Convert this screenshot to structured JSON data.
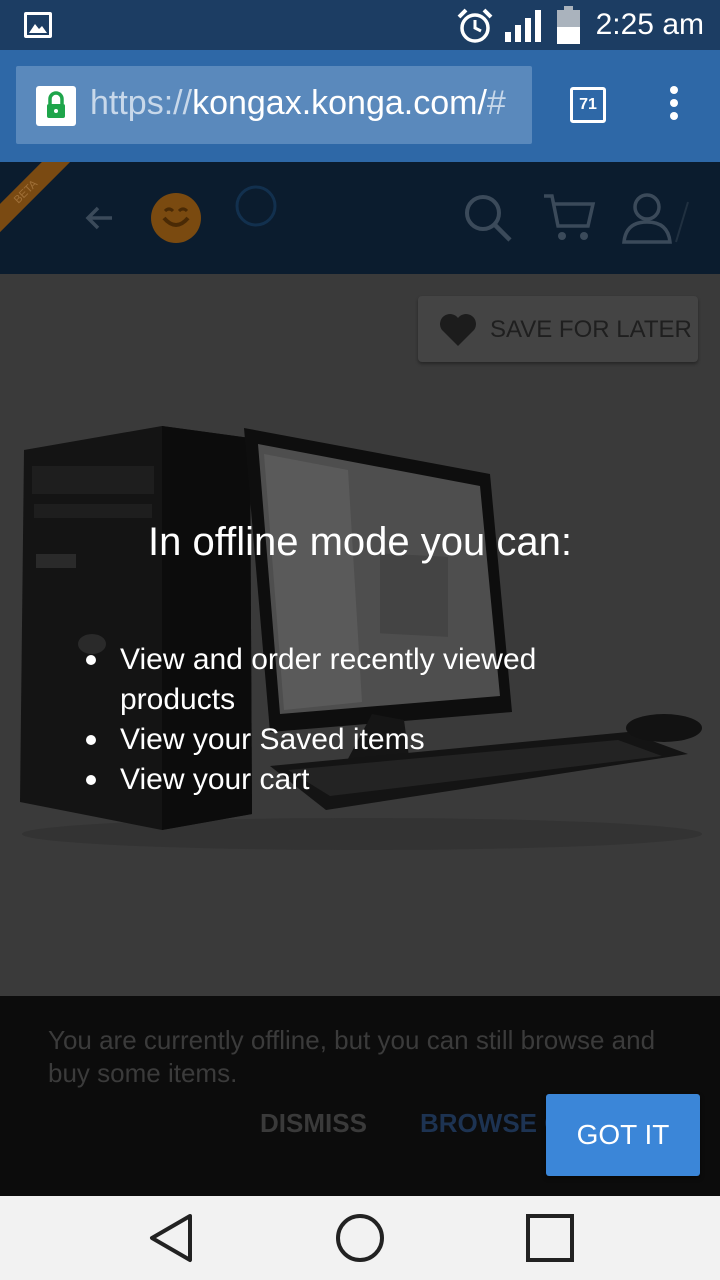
{
  "status_bar": {
    "time": "2:25 am",
    "icons": [
      "image-notification-icon",
      "alarm-icon",
      "signal-icon",
      "battery-icon"
    ]
  },
  "browser": {
    "url_scheme": "https://",
    "url_host": "kongax.konga.com/",
    "url_rest": "#",
    "tab_count": "71",
    "icons": [
      "lock-icon",
      "tabs-icon",
      "menu-icon"
    ]
  },
  "app_header": {
    "beta_label": "BETA",
    "icons": [
      "back-arrow-icon",
      "konga-logo-icon",
      "search-icon",
      "cart-icon",
      "user-icon"
    ]
  },
  "page": {
    "save_for_later_label": "SAVE FOR LATER"
  },
  "offline_overlay": {
    "title": "In offline mode you can:",
    "items": [
      "View and order recently viewed products",
      "View your Saved items",
      "View your cart"
    ]
  },
  "snackbar": {
    "message": "You are currently offline, but you can still browse and buy some items.",
    "dismiss_label": "DISMISS",
    "browse_label": "BROWSE OFFLINE",
    "got_it_label": "GOT IT"
  },
  "nav_bar": {
    "icons": [
      "back-icon",
      "home-icon",
      "recents-icon"
    ]
  },
  "colors": {
    "status_bar": "#1c3d63",
    "browser_bar": "#2e68a7",
    "got_it_button": "#3b86d8",
    "lock_green": "#1ea54a"
  }
}
